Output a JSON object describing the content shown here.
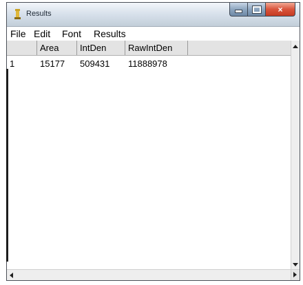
{
  "window": {
    "title": "Results",
    "app_icon": "imagej-icon",
    "controls": {
      "minimize": "minimize-icon",
      "maximize": "maximize-icon",
      "close": "×"
    }
  },
  "menubar": {
    "items": [
      "File",
      "Edit",
      "Font",
      "Results"
    ]
  },
  "table": {
    "columns": [
      "",
      "Area",
      "IntDen",
      "RawIntDen"
    ],
    "rows": [
      [
        "1",
        "15177",
        "509431",
        "11888978"
      ]
    ]
  },
  "colors": {
    "close_button": "#d9543c",
    "titlebar": "#d9e2ec",
    "header_bg": "#e3e3e3"
  }
}
